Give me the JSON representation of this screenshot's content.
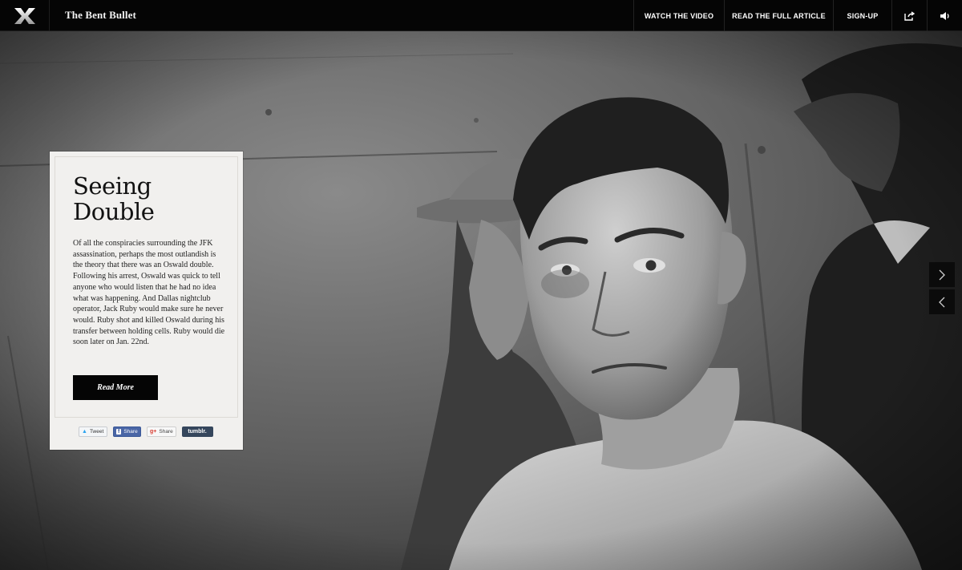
{
  "header": {
    "site_title": "The Bent Bullet",
    "nav": {
      "watch_video": "WATCH THE VIDEO",
      "read_article": "READ THE FULL ARTICLE",
      "sign_up": "SIGN-UP"
    },
    "icons": {
      "logo": "x-logo-icon",
      "share": "share-icon",
      "sound": "speaker-icon"
    }
  },
  "card": {
    "title_line1": "Seeing",
    "title_line2": "Double",
    "body": "Of all the conspiracies surrounding the JFK assassination, perhaps the most outlandish is the theory that there was an Oswald double. Following his arrest, Oswald was quick to tell anyone who would listen that he had no idea what was happening. And Dallas nightclub operator, Jack Ruby would make sure he never would. Ruby shot and killed Oswald during his transfer between holding cells. Ruby would die soon later on Jan. 22nd.",
    "read_more": "Read More",
    "share": {
      "tweet": "Tweet",
      "facebook": "Share",
      "gplus": "Share",
      "tumblr": "tumblr."
    }
  },
  "controls": {
    "next_icon": "chevron-right-icon",
    "prev_icon": "chevron-left-icon"
  },
  "colors": {
    "topbar": "#050505",
    "card_bg": "#f1f0ee",
    "button_bg": "#050505",
    "facebook": "#4a66a6",
    "tumblr": "#35465c"
  }
}
